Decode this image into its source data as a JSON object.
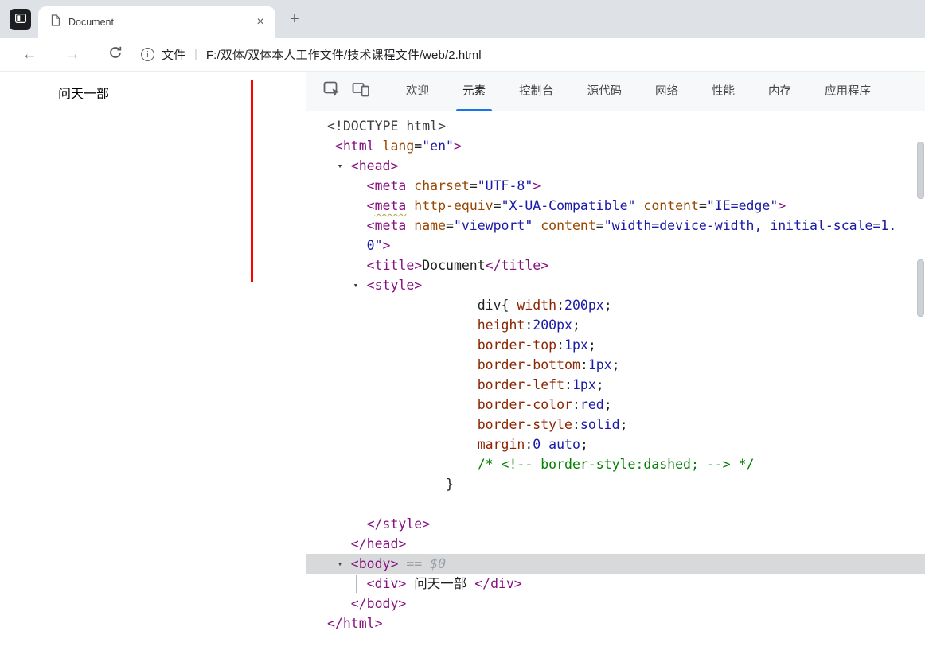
{
  "browser": {
    "tab_title": "Document",
    "glyphs": {
      "close": "×",
      "new_tab": "+",
      "back": "←",
      "forward": "→",
      "info": "i",
      "separator": "|"
    },
    "address": {
      "scheme_label": "文件",
      "path": "F:/双体/双体本人工作文件/技术课程文件/web/2.html"
    }
  },
  "page": {
    "box_text": "问天一部"
  },
  "devtools": {
    "tabs": [
      {
        "id": "welcome",
        "label": "欢迎"
      },
      {
        "id": "elements",
        "label": "元素",
        "active": true
      },
      {
        "id": "console",
        "label": "控制台"
      },
      {
        "id": "sources",
        "label": "源代码"
      },
      {
        "id": "network",
        "label": "网络"
      },
      {
        "id": "performance",
        "label": "性能"
      },
      {
        "id": "memory",
        "label": "内存"
      },
      {
        "id": "application",
        "label": "应用程序"
      }
    ],
    "arrow_glyph": "▾",
    "code": {
      "lines": [
        {
          "indent": 0,
          "tokens": [
            {
              "c": "doctype",
              "s": "<!DOCTYPE html>"
            }
          ]
        },
        {
          "indent": 1,
          "tokens": [
            {
              "c": "tag",
              "s": "<html "
            },
            {
              "c": "attr",
              "s": "lang"
            },
            {
              "c": "punct",
              "s": "="
            },
            {
              "c": "val",
              "s": "\"en\""
            },
            {
              "c": "tag",
              "s": ">"
            }
          ]
        },
        {
          "indent": 3,
          "arrow": true,
          "tokens": [
            {
              "c": "tag",
              "s": "<head>"
            }
          ]
        },
        {
          "indent": 5,
          "tokens": [
            {
              "c": "tag",
              "s": "<meta"
            },
            {
              "c": "attr",
              "s": " charset"
            },
            {
              "c": "punct",
              "s": "="
            },
            {
              "c": "val",
              "s": "\"UTF-8\""
            },
            {
              "c": "tag",
              "s": ">"
            }
          ]
        },
        {
          "indent": 5,
          "tokens": [
            {
              "c": "tag",
              "s": "<"
            },
            {
              "c": "tag",
              "s": "meta",
              "u": 1
            },
            {
              "c": "attr",
              "s": " http-equiv"
            },
            {
              "c": "punct",
              "s": "="
            },
            {
              "c": "val",
              "s": "\"X-UA-Compatible\""
            },
            {
              "c": "attr",
              "s": " content"
            },
            {
              "c": "punct",
              "s": "="
            },
            {
              "c": "val",
              "s": "\"IE=edge\""
            },
            {
              "c": "tag",
              "s": ">"
            }
          ]
        },
        {
          "indent": 5,
          "tokens": [
            {
              "c": "tag",
              "s": "<meta"
            },
            {
              "c": "attr",
              "s": " name"
            },
            {
              "c": "punct",
              "s": "="
            },
            {
              "c": "val",
              "s": "\"viewport\""
            },
            {
              "c": "attr",
              "s": " content"
            },
            {
              "c": "punct",
              "s": "="
            },
            {
              "c": "val",
              "s": "\"width=device-width, initial-scale=1."
            }
          ]
        },
        {
          "indent": 5,
          "tokens": [
            {
              "c": "val",
              "s": "0\""
            },
            {
              "c": "tag",
              "s": ">"
            }
          ]
        },
        {
          "indent": 5,
          "tokens": [
            {
              "c": "tag",
              "s": "<title>"
            },
            {
              "c": "text",
              "s": "Document"
            },
            {
              "c": "tag",
              "s": "</title>"
            }
          ]
        },
        {
          "indent": 5,
          "arrow": true,
          "tokens": [
            {
              "c": "tag",
              "s": "<style>"
            }
          ]
        },
        {
          "indent": 19,
          "tokens": [
            {
              "c": "text",
              "s": "div{ "
            },
            {
              "c": "prop",
              "s": "width"
            },
            {
              "c": "punct",
              "s": ":"
            },
            {
              "c": "cssval",
              "s": "200px"
            },
            {
              "c": "punct",
              "s": ";"
            }
          ]
        },
        {
          "indent": 19,
          "tokens": [
            {
              "c": "prop",
              "s": "height"
            },
            {
              "c": "punct",
              "s": ":"
            },
            {
              "c": "cssval",
              "s": "200px"
            },
            {
              "c": "punct",
              "s": ";"
            }
          ]
        },
        {
          "indent": 19,
          "tokens": [
            {
              "c": "prop",
              "s": "border-top"
            },
            {
              "c": "punct",
              "s": ":"
            },
            {
              "c": "cssval",
              "s": "1px"
            },
            {
              "c": "punct",
              "s": ";"
            }
          ]
        },
        {
          "indent": 19,
          "tokens": [
            {
              "c": "prop",
              "s": "border-bottom"
            },
            {
              "c": "punct",
              "s": ":"
            },
            {
              "c": "cssval",
              "s": "1px"
            },
            {
              "c": "punct",
              "s": ";"
            }
          ]
        },
        {
          "indent": 19,
          "tokens": [
            {
              "c": "prop",
              "s": "border-left"
            },
            {
              "c": "punct",
              "s": ":"
            },
            {
              "c": "cssval",
              "s": "1px"
            },
            {
              "c": "punct",
              "s": ";"
            }
          ]
        },
        {
          "indent": 19,
          "tokens": [
            {
              "c": "prop",
              "s": "border-color"
            },
            {
              "c": "punct",
              "s": ":"
            },
            {
              "c": "cssval",
              "s": "red"
            },
            {
              "c": "punct",
              "s": ";"
            }
          ]
        },
        {
          "indent": 19,
          "tokens": [
            {
              "c": "prop",
              "s": "border-style"
            },
            {
              "c": "punct",
              "s": ":"
            },
            {
              "c": "cssval",
              "s": "solid"
            },
            {
              "c": "punct",
              "s": ";"
            }
          ]
        },
        {
          "indent": 19,
          "tokens": [
            {
              "c": "prop",
              "s": "margin"
            },
            {
              "c": "punct",
              "s": ":"
            },
            {
              "c": "cssval",
              "s": "0 auto"
            },
            {
              "c": "punct",
              "s": ";"
            }
          ]
        },
        {
          "indent": 19,
          "tokens": [
            {
              "c": "comment",
              "s": "/* <!-- border-style:dashed; --> */"
            }
          ]
        },
        {
          "indent": 15,
          "tokens": [
            {
              "c": "punct",
              "s": "}"
            }
          ]
        },
        {
          "indent": 0,
          "tokens": []
        },
        {
          "indent": 5,
          "tokens": [
            {
              "c": "tag",
              "s": "</style>"
            }
          ]
        },
        {
          "indent": 3,
          "tokens": [
            {
              "c": "tag",
              "s": "</head>"
            }
          ]
        },
        {
          "indent": 3,
          "arrow": true,
          "selected": true,
          "tokens": [
            {
              "c": "tag",
              "s": "<body>"
            },
            {
              "c": "eq",
              "s": " == "
            },
            {
              "c": "dollar",
              "s": "$0"
            }
          ]
        },
        {
          "indent": 5,
          "guide": 62,
          "tokens": [
            {
              "c": "tag",
              "s": "<div>"
            },
            {
              "c": "text",
              "s": " 问天一部 "
            },
            {
              "c": "tag",
              "s": "</div>"
            }
          ]
        },
        {
          "indent": 3,
          "tokens": [
            {
              "c": "tag",
              "s": "</body>"
            }
          ]
        },
        {
          "indent": 0,
          "tokens": [
            {
              "c": "tag",
              "s": "</html>"
            }
          ]
        }
      ]
    }
  },
  "colors": {
    "accent_blue": "#1a73e8",
    "tag": "#881280",
    "attr_name": "#994500",
    "attr_value": "#1a1aa6",
    "css_property": "#8b2500",
    "css_value": "#1a1aa6",
    "comment": "#007f00",
    "selection_bg": "#d8d9db",
    "box_border": "#ff0000"
  }
}
